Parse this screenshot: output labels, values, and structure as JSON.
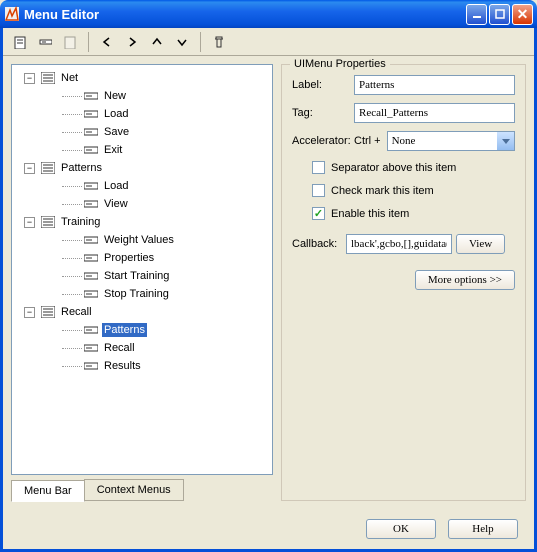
{
  "window": {
    "title": "Menu Editor"
  },
  "tree": {
    "nodes": [
      {
        "label": "Net",
        "depth": 1,
        "kind": "menu",
        "expanded": true
      },
      {
        "label": "New",
        "depth": 2,
        "kind": "item"
      },
      {
        "label": "Load",
        "depth": 2,
        "kind": "item"
      },
      {
        "label": "Save",
        "depth": 2,
        "kind": "item"
      },
      {
        "label": "Exit",
        "depth": 2,
        "kind": "item"
      },
      {
        "label": "Patterns",
        "depth": 1,
        "kind": "menu",
        "expanded": true
      },
      {
        "label": "Load",
        "depth": 2,
        "kind": "item"
      },
      {
        "label": "View",
        "depth": 2,
        "kind": "item"
      },
      {
        "label": "Training",
        "depth": 1,
        "kind": "menu",
        "expanded": true
      },
      {
        "label": "Weight Values",
        "depth": 2,
        "kind": "item"
      },
      {
        "label": "Properties",
        "depth": 2,
        "kind": "item"
      },
      {
        "label": "Start Training",
        "depth": 2,
        "kind": "item"
      },
      {
        "label": "Stop Training",
        "depth": 2,
        "kind": "item"
      },
      {
        "label": "Recall",
        "depth": 1,
        "kind": "menu",
        "expanded": true
      },
      {
        "label": "Patterns",
        "depth": 2,
        "kind": "item",
        "selected": true
      },
      {
        "label": "Recall",
        "depth": 2,
        "kind": "item"
      },
      {
        "label": "Results",
        "depth": 2,
        "kind": "item"
      }
    ]
  },
  "tabs": {
    "active": "Menu Bar",
    "other": "Context Menus"
  },
  "props": {
    "title": "UIMenu Properties",
    "labelField": "Label:",
    "labelValue": "Patterns",
    "tagField": "Tag:",
    "tagValue": "Recall_Patterns",
    "accField": "Accelerator:",
    "accPrefix": "Ctrl +",
    "accValue": "None",
    "sep": {
      "checked": false,
      "text": "Separator above this item"
    },
    "chk": {
      "checked": false,
      "text": "Check mark this item"
    },
    "enb": {
      "checked": true,
      "text": "Enable this item"
    },
    "cbField": "Callback:",
    "cbValue": "lback',gcbo,[],guidata(gcl",
    "viewBtn": "View",
    "moreBtn": "More options >>"
  },
  "footer": {
    "ok": "OK",
    "help": "Help"
  }
}
